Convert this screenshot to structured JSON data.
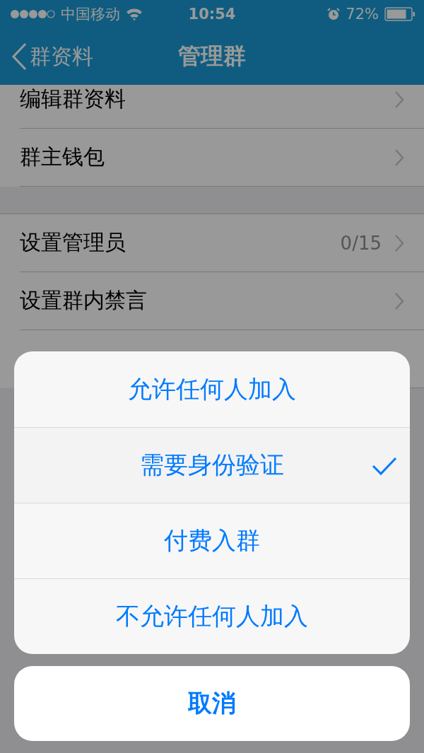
{
  "status_bar": {
    "carrier": "中国移动",
    "time": "10:54",
    "battery": "72%"
  },
  "nav": {
    "back": "群资料",
    "title": "管理群"
  },
  "groups": [
    {
      "rows": [
        {
          "label": "编辑群资料"
        },
        {
          "label": "群主钱包"
        }
      ]
    },
    {
      "rows": [
        {
          "label": "设置管理员",
          "value": "0/15"
        },
        {
          "label": "设置群内禁言"
        }
      ]
    }
  ],
  "action_sheet": {
    "options": [
      {
        "label": "允许任何人加入",
        "selected": false
      },
      {
        "label": "需要身份验证",
        "selected": true
      },
      {
        "label": "付费入群",
        "selected": false
      },
      {
        "label": "不允许任何人加入",
        "selected": false
      }
    ],
    "cancel": "取消"
  }
}
